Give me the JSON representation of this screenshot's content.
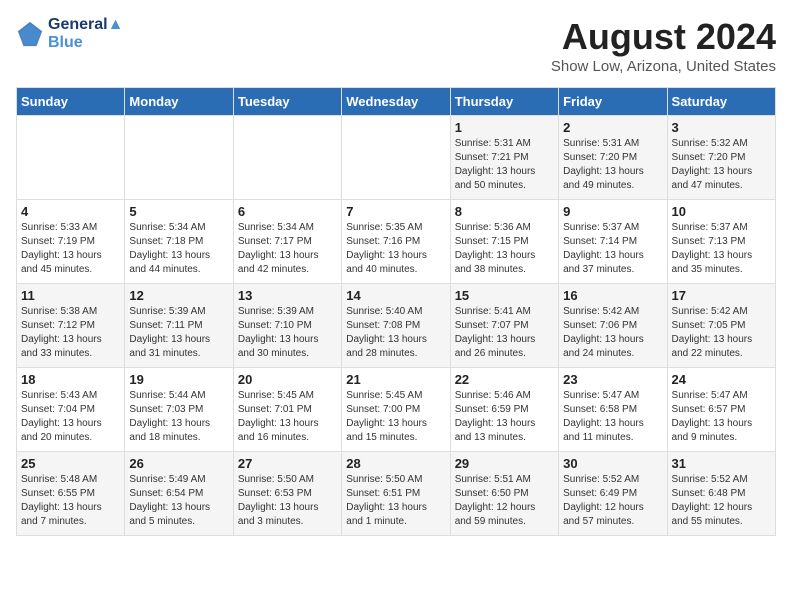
{
  "header": {
    "logo_line1": "General",
    "logo_line2": "Blue",
    "title": "August 2024",
    "subtitle": "Show Low, Arizona, United States"
  },
  "days_of_week": [
    "Sunday",
    "Monday",
    "Tuesday",
    "Wednesday",
    "Thursday",
    "Friday",
    "Saturday"
  ],
  "weeks": [
    [
      {
        "day": "",
        "info": ""
      },
      {
        "day": "",
        "info": ""
      },
      {
        "day": "",
        "info": ""
      },
      {
        "day": "",
        "info": ""
      },
      {
        "day": "1",
        "info": "Sunrise: 5:31 AM\nSunset: 7:21 PM\nDaylight: 13 hours\nand 50 minutes."
      },
      {
        "day": "2",
        "info": "Sunrise: 5:31 AM\nSunset: 7:20 PM\nDaylight: 13 hours\nand 49 minutes."
      },
      {
        "day": "3",
        "info": "Sunrise: 5:32 AM\nSunset: 7:20 PM\nDaylight: 13 hours\nand 47 minutes."
      }
    ],
    [
      {
        "day": "4",
        "info": "Sunrise: 5:33 AM\nSunset: 7:19 PM\nDaylight: 13 hours\nand 45 minutes."
      },
      {
        "day": "5",
        "info": "Sunrise: 5:34 AM\nSunset: 7:18 PM\nDaylight: 13 hours\nand 44 minutes."
      },
      {
        "day": "6",
        "info": "Sunrise: 5:34 AM\nSunset: 7:17 PM\nDaylight: 13 hours\nand 42 minutes."
      },
      {
        "day": "7",
        "info": "Sunrise: 5:35 AM\nSunset: 7:16 PM\nDaylight: 13 hours\nand 40 minutes."
      },
      {
        "day": "8",
        "info": "Sunrise: 5:36 AM\nSunset: 7:15 PM\nDaylight: 13 hours\nand 38 minutes."
      },
      {
        "day": "9",
        "info": "Sunrise: 5:37 AM\nSunset: 7:14 PM\nDaylight: 13 hours\nand 37 minutes."
      },
      {
        "day": "10",
        "info": "Sunrise: 5:37 AM\nSunset: 7:13 PM\nDaylight: 13 hours\nand 35 minutes."
      }
    ],
    [
      {
        "day": "11",
        "info": "Sunrise: 5:38 AM\nSunset: 7:12 PM\nDaylight: 13 hours\nand 33 minutes."
      },
      {
        "day": "12",
        "info": "Sunrise: 5:39 AM\nSunset: 7:11 PM\nDaylight: 13 hours\nand 31 minutes."
      },
      {
        "day": "13",
        "info": "Sunrise: 5:39 AM\nSunset: 7:10 PM\nDaylight: 13 hours\nand 30 minutes."
      },
      {
        "day": "14",
        "info": "Sunrise: 5:40 AM\nSunset: 7:08 PM\nDaylight: 13 hours\nand 28 minutes."
      },
      {
        "day": "15",
        "info": "Sunrise: 5:41 AM\nSunset: 7:07 PM\nDaylight: 13 hours\nand 26 minutes."
      },
      {
        "day": "16",
        "info": "Sunrise: 5:42 AM\nSunset: 7:06 PM\nDaylight: 13 hours\nand 24 minutes."
      },
      {
        "day": "17",
        "info": "Sunrise: 5:42 AM\nSunset: 7:05 PM\nDaylight: 13 hours\nand 22 minutes."
      }
    ],
    [
      {
        "day": "18",
        "info": "Sunrise: 5:43 AM\nSunset: 7:04 PM\nDaylight: 13 hours\nand 20 minutes."
      },
      {
        "day": "19",
        "info": "Sunrise: 5:44 AM\nSunset: 7:03 PM\nDaylight: 13 hours\nand 18 minutes."
      },
      {
        "day": "20",
        "info": "Sunrise: 5:45 AM\nSunset: 7:01 PM\nDaylight: 13 hours\nand 16 minutes."
      },
      {
        "day": "21",
        "info": "Sunrise: 5:45 AM\nSunset: 7:00 PM\nDaylight: 13 hours\nand 15 minutes."
      },
      {
        "day": "22",
        "info": "Sunrise: 5:46 AM\nSunset: 6:59 PM\nDaylight: 13 hours\nand 13 minutes."
      },
      {
        "day": "23",
        "info": "Sunrise: 5:47 AM\nSunset: 6:58 PM\nDaylight: 13 hours\nand 11 minutes."
      },
      {
        "day": "24",
        "info": "Sunrise: 5:47 AM\nSunset: 6:57 PM\nDaylight: 13 hours\nand 9 minutes."
      }
    ],
    [
      {
        "day": "25",
        "info": "Sunrise: 5:48 AM\nSunset: 6:55 PM\nDaylight: 13 hours\nand 7 minutes."
      },
      {
        "day": "26",
        "info": "Sunrise: 5:49 AM\nSunset: 6:54 PM\nDaylight: 13 hours\nand 5 minutes."
      },
      {
        "day": "27",
        "info": "Sunrise: 5:50 AM\nSunset: 6:53 PM\nDaylight: 13 hours\nand 3 minutes."
      },
      {
        "day": "28",
        "info": "Sunrise: 5:50 AM\nSunset: 6:51 PM\nDaylight: 13 hours\nand 1 minute."
      },
      {
        "day": "29",
        "info": "Sunrise: 5:51 AM\nSunset: 6:50 PM\nDaylight: 12 hours\nand 59 minutes."
      },
      {
        "day": "30",
        "info": "Sunrise: 5:52 AM\nSunset: 6:49 PM\nDaylight: 12 hours\nand 57 minutes."
      },
      {
        "day": "31",
        "info": "Sunrise: 5:52 AM\nSunset: 6:48 PM\nDaylight: 12 hours\nand 55 minutes."
      }
    ]
  ]
}
